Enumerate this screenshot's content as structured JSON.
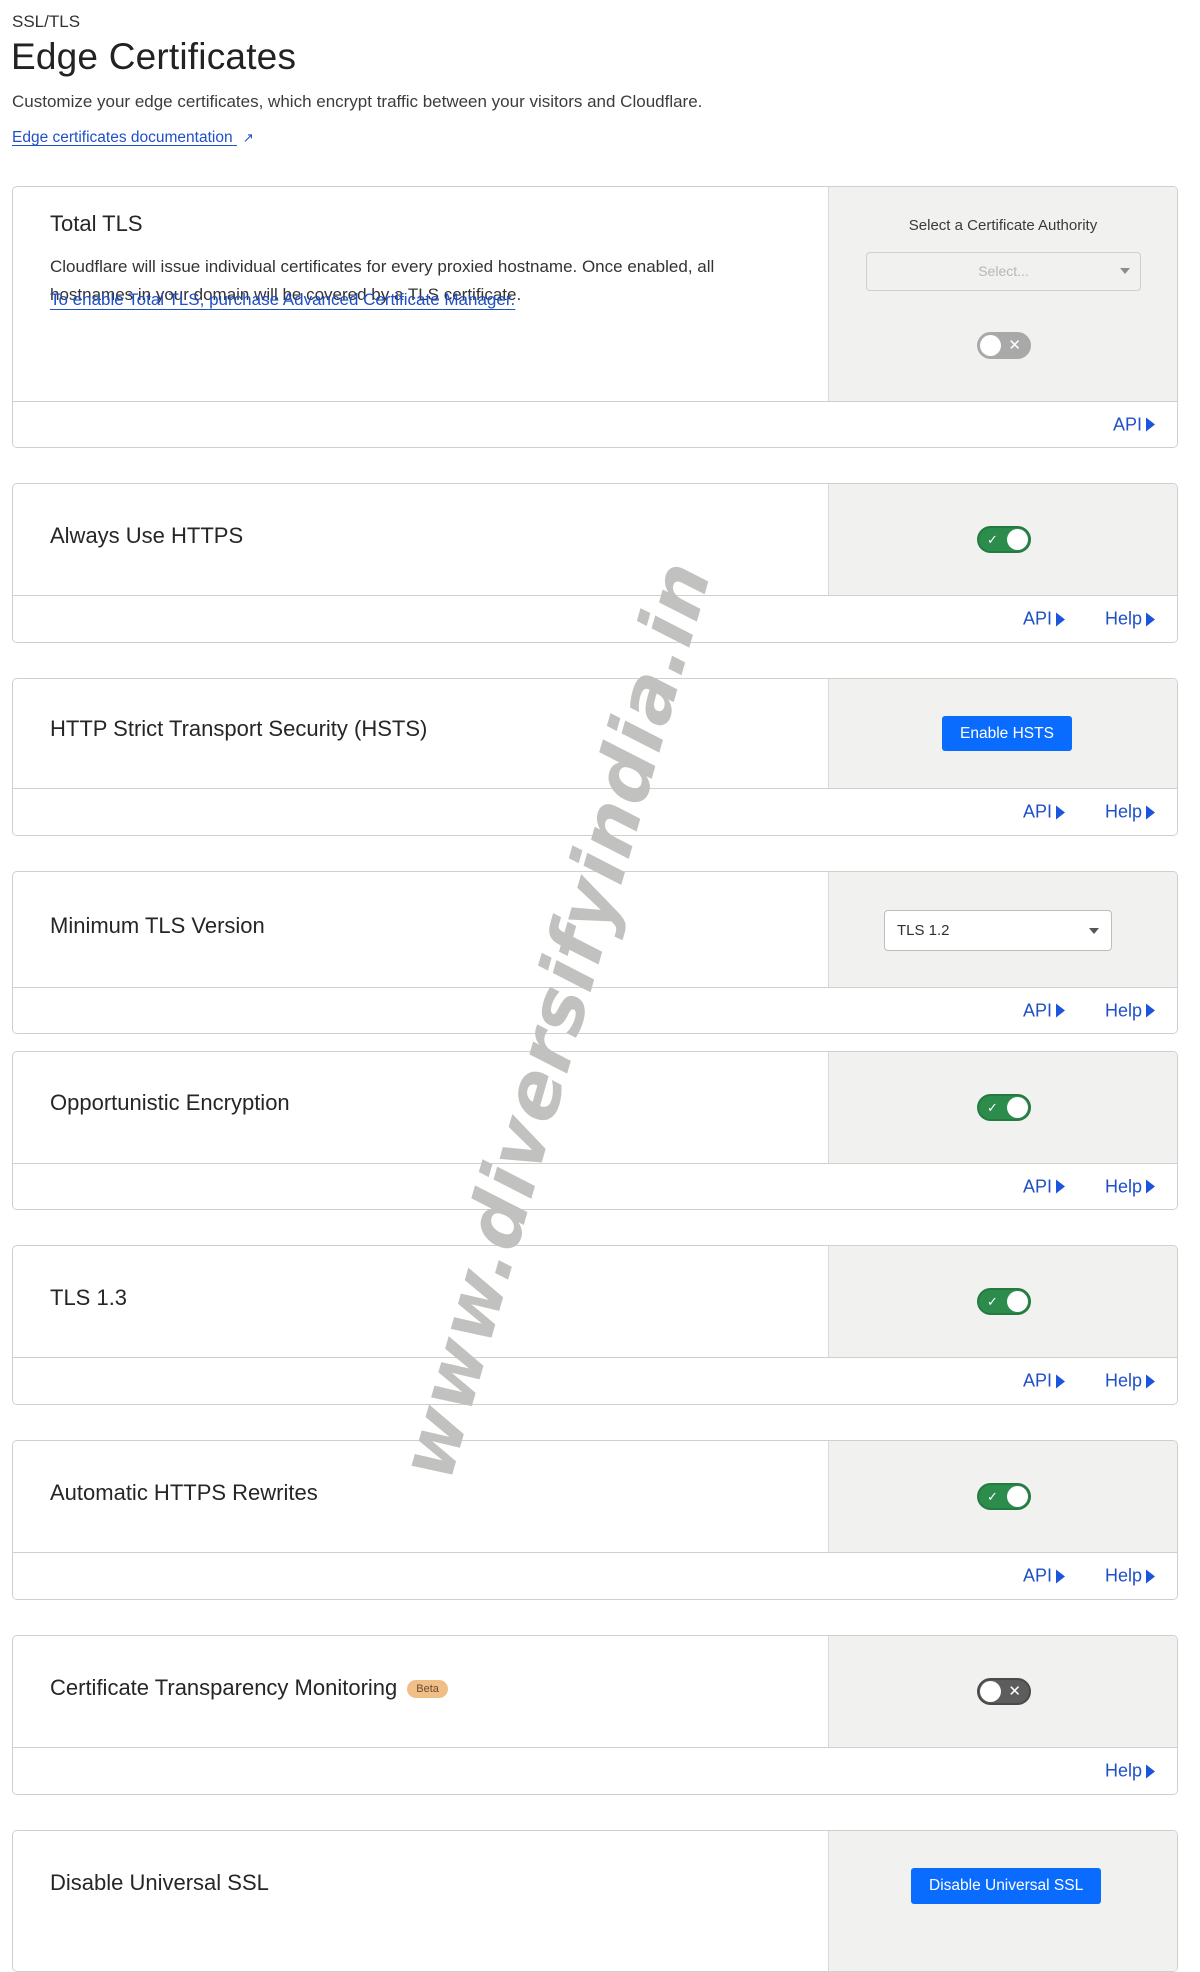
{
  "header": {
    "breadcrumb": "SSL/TLS",
    "title": "Edge Certificates",
    "subtitle": "Customize your edge certificates, which encrypt traffic between your visitors and Cloudflare.",
    "doc_link": "Edge certificates documentation",
    "doc_link_icon": "external-link-icon"
  },
  "colors": {
    "link": "#1f50c8",
    "primary_button": "#0a6cff",
    "toggle_on": "#2c8c4c",
    "toggle_off": "#5d5d5d",
    "toggle_disabled": "#a9a9a9",
    "panel_bg": "#f1f2f0",
    "beta_badge": "#f0bf88",
    "watermark": "#c0c0bf"
  },
  "cards": {
    "total_tls": {
      "title": "Total TLS",
      "description": "Cloudflare will issue individual certificates for every proxied hostname. Once enabled, all hostnames in your domain will be covered by a TLS certificate.",
      "link": "To enable Total TLS, purchase Advanced Certificate Manager.",
      "ca_label": "Select a Certificate Authority",
      "ca_placeholder": "Select...",
      "toggle_state": "off (disabled)",
      "footer": {
        "api": "API"
      }
    },
    "always_https": {
      "title": "Always Use HTTPS",
      "toggle_state": "on",
      "footer": {
        "api": "API",
        "help": "Help"
      }
    },
    "hsts": {
      "title": "HTTP Strict Transport Security (HSTS)",
      "button": "Enable HSTS",
      "footer": {
        "api": "API",
        "help": "Help"
      }
    },
    "min_tls": {
      "title": "Minimum TLS Version",
      "selected": "TLS 1.2",
      "footer": {
        "api": "API",
        "help": "Help"
      }
    },
    "opportunistic": {
      "title": "Opportunistic Encryption",
      "toggle_state": "on",
      "footer": {
        "api": "API",
        "help": "Help"
      }
    },
    "tls13": {
      "title": "TLS 1.3",
      "toggle_state": "on",
      "footer": {
        "api": "API",
        "help": "Help"
      }
    },
    "auto_rewrites": {
      "title": "Automatic HTTPS Rewrites",
      "toggle_state": "on",
      "footer": {
        "api": "API",
        "help": "Help"
      }
    },
    "ct_monitoring": {
      "title": "Certificate Transparency Monitoring",
      "badge": "Beta",
      "toggle_state": "off",
      "footer": {
        "help": "Help"
      }
    },
    "disable_universal": {
      "title": "Disable Universal SSL",
      "button": "Disable Universal SSL"
    }
  },
  "icons": {
    "check": "✓",
    "cross": "✕",
    "external": "⧉"
  },
  "watermark": "www.diversifyindia.in"
}
